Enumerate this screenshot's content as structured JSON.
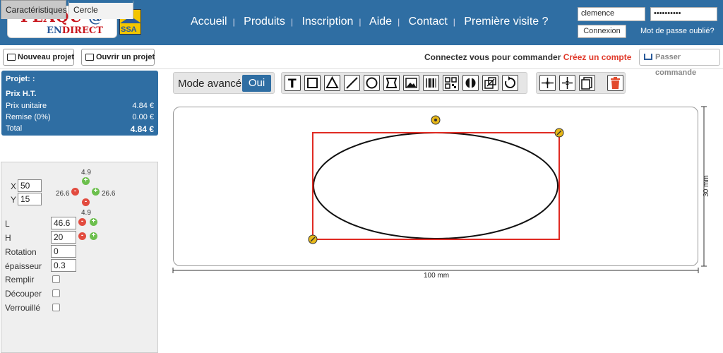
{
  "header": {
    "logo": {
      "line1": "PLAQU",
      "line1_at": "'@",
      "line2_a": "EN",
      "line2_b": "DIRECT"
    },
    "badge": "SSA",
    "nav": [
      "Accueil",
      "Produits",
      "Inscription",
      "Aide",
      "Contact",
      "Première visite ?"
    ],
    "nav_sep": "|",
    "login": {
      "username": "clemence",
      "password": "••••••••••",
      "button": "Connexion",
      "forgot": "Mot de passe oublié?"
    }
  },
  "toolbar": {
    "new_project": "Nouveau projet",
    "open_project": "Ouvrir un projet",
    "connect_msg": "Connectez vous pour commander",
    "create_account": "Créez un compte",
    "order": "Passer commande"
  },
  "price": {
    "title": "Projet: :",
    "label": "Prix H.T.",
    "rows": [
      {
        "name": "Prix unitaire",
        "value": "4.84 €"
      },
      {
        "name": "Remise (0%)",
        "value": "0.00 €"
      },
      {
        "name": "Total",
        "value": "4.84 €"
      }
    ]
  },
  "panel": {
    "tabs": [
      "Caractéristiques",
      "Cercle"
    ],
    "x_label": "X",
    "x_value": "50",
    "y_label": "Y",
    "y_value": "15",
    "nudge": {
      "top": "4.9",
      "left": "26.6",
      "right": "26.6",
      "bottom": "4.9"
    },
    "l_label": "L",
    "l_value": "46.6",
    "h_label": "H",
    "h_value": "20",
    "rotation_label": "Rotation",
    "rotation_value": "0",
    "thickness_label": "épaisseur",
    "thickness_value": "0.3",
    "fill_label": "Remplir",
    "cut_label": "Découper",
    "lock_label": "Verrouillé"
  },
  "mode": {
    "label": "Mode avancé",
    "value": "Oui"
  },
  "tools": [
    "text-tool",
    "rectangle-tool",
    "triangle-tool",
    "line-tool",
    "circle-tool",
    "shape-tool",
    "image-tool",
    "barcode-tool",
    "qrcode-tool",
    "symbol-tool",
    "resize-tool",
    "rotate-tool"
  ],
  "align_tools": [
    "align-horizontal-center",
    "align-vertical-center",
    "duplicate",
    "delete"
  ],
  "canvas": {
    "width_label": "100 mm",
    "height_label": "30 mm"
  },
  "colors": {
    "header": "#2f6ea3",
    "selection": "#e02b23",
    "accent_red": "#e03a2b"
  }
}
